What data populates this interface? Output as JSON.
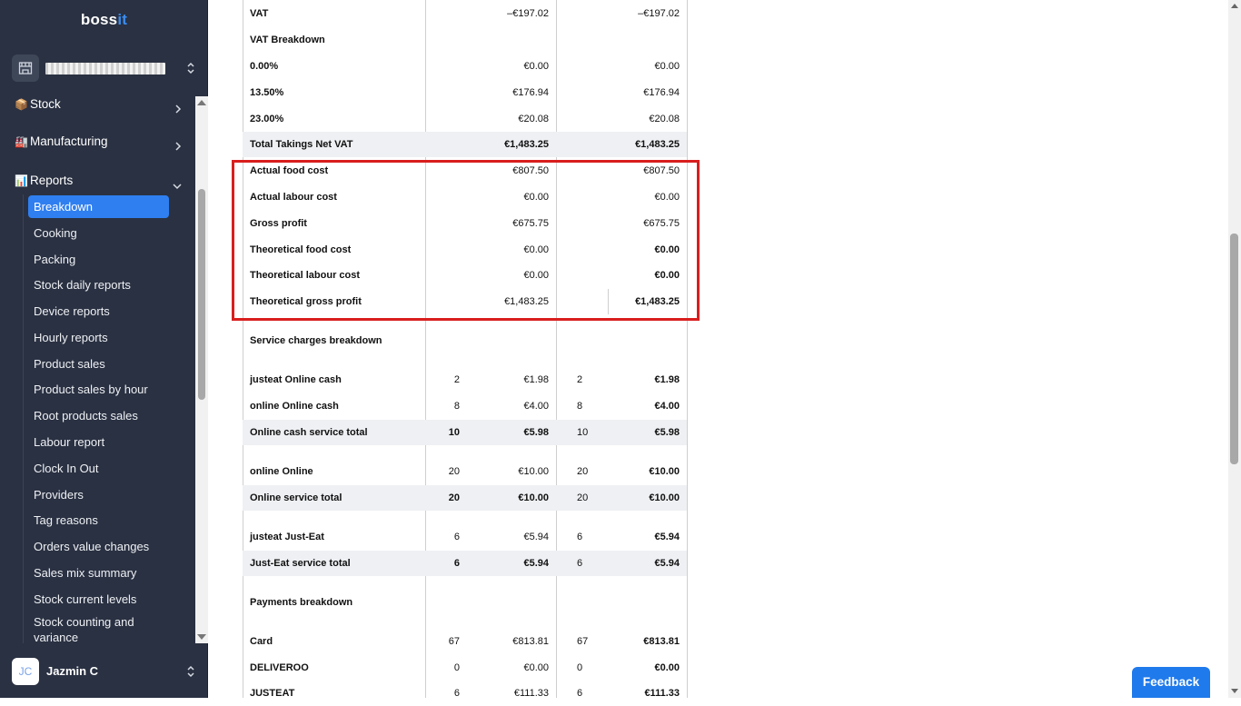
{
  "brand": {
    "name_part1": "boss",
    "name_part2": "it",
    "accent": "#3b8cf0"
  },
  "sidebar": {
    "menu": [
      {
        "emoji": "📦",
        "label": "Stock",
        "chevron": "chevron-right"
      },
      {
        "emoji": "🏭",
        "label": "Manufacturing",
        "chevron": "chevron-right"
      },
      {
        "emoji": "📊",
        "label": "Reports",
        "chevron": "chevron-down"
      }
    ],
    "report_items": [
      "Breakdown",
      "Cooking",
      "Packing",
      "Stock daily reports",
      "Device reports",
      "Hourly reports",
      "Product sales",
      "Product sales by hour",
      "Root products sales",
      "Labour report",
      "Clock In Out",
      "Providers",
      "Tag reasons",
      "Orders value changes",
      "Sales mix summary",
      "Stock current levels",
      "Stock counting and variance"
    ],
    "active_item": "Breakdown",
    "user": {
      "initials": "JC",
      "name": "Jazmin C"
    }
  },
  "table": {
    "rows": [
      {
        "label": "VAT",
        "c1": "",
        "v1": "–€197.02",
        "c2": "",
        "v2": "–€197.02"
      },
      {
        "label": "VAT Breakdown",
        "c1": "",
        "v1": "",
        "c2": "",
        "v2": ""
      },
      {
        "label": "0.00%",
        "c1": "",
        "v1": "€0.00",
        "c2": "",
        "v2": "€0.00"
      },
      {
        "label": "13.50%",
        "c1": "",
        "v1": "€176.94",
        "c2": "",
        "v2": "€176.94"
      },
      {
        "label": "23.00%",
        "c1": "",
        "v1": "€20.08",
        "c2": "",
        "v2": "€20.08"
      },
      {
        "label": "Total Takings Net VAT",
        "c1": "",
        "v1": "€1,483.25",
        "c2": "",
        "v2": "€1,483.25"
      },
      {
        "label": "Actual food cost",
        "c1": "",
        "v1": "€807.50",
        "c2": "",
        "v2": "€807.50"
      },
      {
        "label": "Actual labour cost",
        "c1": "",
        "v1": "€0.00",
        "c2": "",
        "v2": "€0.00"
      },
      {
        "label": "Gross profit",
        "c1": "",
        "v1": "€675.75",
        "c2": "",
        "v2": "€675.75"
      },
      {
        "label": "Theoretical food cost",
        "c1": "",
        "v1": "€0.00",
        "c2": "",
        "v2": "€0.00"
      },
      {
        "label": "Theoretical labour cost",
        "c1": "",
        "v1": "€0.00",
        "c2": "",
        "v2": "€0.00"
      },
      {
        "label": "Theoretical gross profit",
        "c1": "",
        "v1": "€1,483.25",
        "c2": "",
        "v2": "€1,483.25"
      },
      {
        "label": "Service charges breakdown",
        "c1": "",
        "v1": "",
        "c2": "",
        "v2": ""
      },
      {
        "label": "justeat Online cash",
        "c1": "2",
        "v1": "€1.98",
        "c2": "2",
        "v2": "€1.98"
      },
      {
        "label": "online Online cash",
        "c1": "8",
        "v1": "€4.00",
        "c2": "8",
        "v2": "€4.00"
      },
      {
        "label": "Online cash service total",
        "c1": "10",
        "v1": "€5.98",
        "c2": "10",
        "v2": "€5.98"
      },
      {
        "label": "online Online",
        "c1": "20",
        "v1": "€10.00",
        "c2": "20",
        "v2": "€10.00"
      },
      {
        "label": "Online service total",
        "c1": "20",
        "v1": "€10.00",
        "c2": "20",
        "v2": "€10.00"
      },
      {
        "label": "justeat Just-Eat",
        "c1": "6",
        "v1": "€5.94",
        "c2": "6",
        "v2": "€5.94"
      },
      {
        "label": "Just-Eat service total",
        "c1": "6",
        "v1": "€5.94",
        "c2": "6",
        "v2": "€5.94"
      },
      {
        "label": "Payments breakdown",
        "c1": "",
        "v1": "",
        "c2": "",
        "v2": ""
      },
      {
        "label": "Card",
        "c1": "67",
        "v1": "€813.81",
        "c2": "67",
        "v2": "€813.81"
      },
      {
        "label": "DELIVEROO",
        "c1": "0",
        "v1": "€0.00",
        "c2": "0",
        "v2": "€0.00"
      },
      {
        "label": "JUSTEAT",
        "c1": "6",
        "v1": "€111.33",
        "c2": "6",
        "v2": "€111.33"
      }
    ]
  },
  "feedback_label": "Feedback",
  "colors": {
    "sidebar_bg": "#2a3142",
    "active": "#2f7ff0",
    "highlight": "#d91e1e",
    "feedback": "#1f7aeb"
  }
}
